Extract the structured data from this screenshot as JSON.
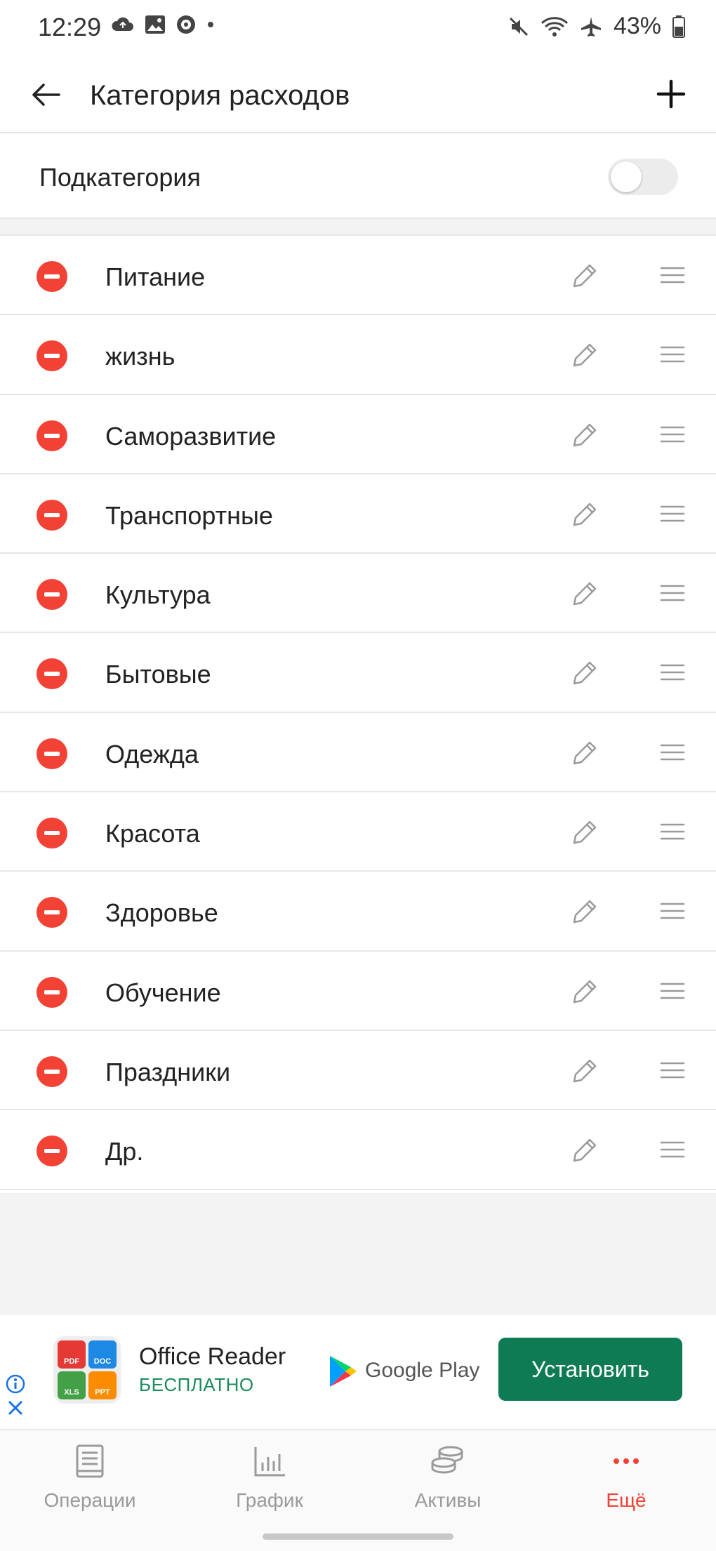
{
  "status": {
    "time": "12:29",
    "battery": "43%"
  },
  "header": {
    "title": "Категория расходов"
  },
  "subcategory": {
    "label": "Подкатегория",
    "enabled": false
  },
  "categories": [
    "Питание",
    "жизнь",
    "Саморазвитие",
    "Транспортные",
    "Культура",
    "Бытовые",
    "Одежда",
    "Красота",
    "Здоровье",
    "Обучение",
    "Праздники",
    "Др."
  ],
  "ad": {
    "title": "Office Reader",
    "subtitle": "БЕСПЛАТНО",
    "store": "Google Play",
    "install_label": "Установить",
    "icon_tiles": [
      "PDF",
      "DOC",
      "XLS",
      "PPT"
    ]
  },
  "nav": [
    {
      "label": "Операции",
      "icon": "book-icon"
    },
    {
      "label": "График",
      "icon": "bar-chart-icon"
    },
    {
      "label": "Активы",
      "icon": "coins-icon"
    },
    {
      "label": "Ещё",
      "icon": "more-dots-icon",
      "active": true
    }
  ],
  "colors": {
    "accent": "#f24235",
    "install": "#0f7b55",
    "ad_sub": "#1a8b5a"
  }
}
